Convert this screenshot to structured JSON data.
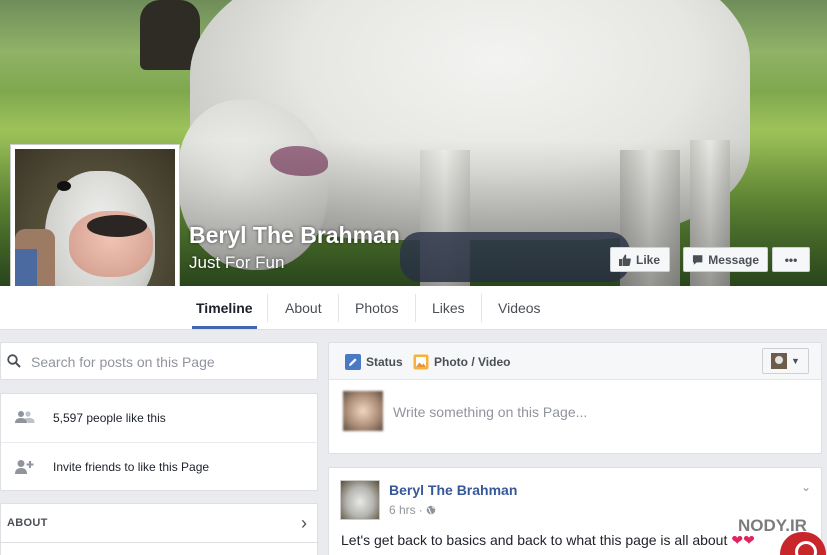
{
  "page": {
    "name": "Beryl The Brahman",
    "category": "Just For Fun"
  },
  "cover_buttons": {
    "like": "Like",
    "message": "Message",
    "more": "•••"
  },
  "tabs": [
    {
      "label": "Timeline",
      "active": true
    },
    {
      "label": "About",
      "active": false
    },
    {
      "label": "Photos",
      "active": false
    },
    {
      "label": "Likes",
      "active": false
    },
    {
      "label": "Videos",
      "active": false
    }
  ],
  "sidebar": {
    "search_placeholder": "Search for posts on this Page",
    "likes_count_text": "5,597 people like this",
    "invite_text": "Invite friends to like this Page",
    "about_label": "ABOUT"
  },
  "composer": {
    "status_label": "Status",
    "photo_video_label": "Photo / Video",
    "placeholder": "Write something on this Page..."
  },
  "post": {
    "author": "Beryl The Brahman",
    "time": "6 hrs",
    "text": "Let's get back to basics and back to what this page is all about"
  },
  "watermark": "NODY.IR",
  "colors": {
    "link_blue": "#365899",
    "tab_active": "#4267b2",
    "background": "#e9ebee"
  }
}
